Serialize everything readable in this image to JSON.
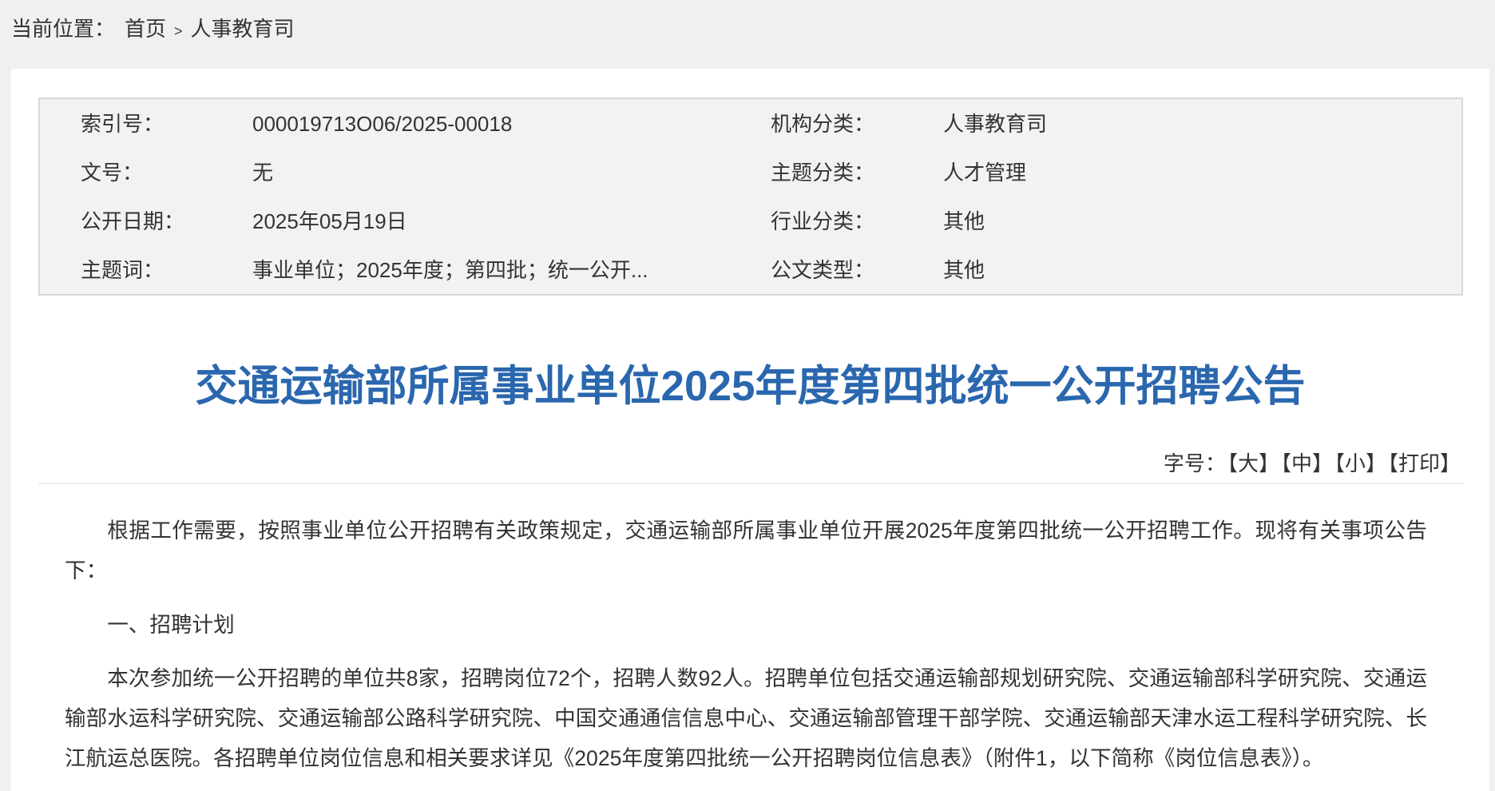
{
  "breadcrumb": {
    "label": "当前位置：",
    "separator": ">",
    "items": [
      "首页",
      "人事教育司"
    ]
  },
  "meta": {
    "rows": [
      {
        "label": "索引号：",
        "value": "000019713O06/2025-00018",
        "label2": "机构分类：",
        "value2": "人事教育司"
      },
      {
        "label": "文号：",
        "value": "无",
        "label2": "主题分类：",
        "value2": "人才管理"
      },
      {
        "label": "公开日期：",
        "value": "2025年05月19日",
        "label2": "行业分类：",
        "value2": "其他"
      },
      {
        "label": "主题词：",
        "value": "事业单位；2025年度；第四批；统一公开...",
        "label2": "公文类型：",
        "value2": "其他"
      }
    ]
  },
  "title": "交通运输部所属事业单位2025年度第四批统一公开招聘公告",
  "font_size_bar": {
    "label": "字号：",
    "options": [
      "【大】",
      "【中】",
      "【小】",
      "【打印】"
    ]
  },
  "article": {
    "paragraphs": [
      {
        "lines": [
          "根据工作需要，按照事业单位公开招聘有关政策规定，交通运输部所属事业单位开展2025年度第四批统一公开招聘工作。现将有关事项公告如",
          "下："
        ]
      },
      {
        "lines": [
          "一、招聘计划"
        ]
      },
      {
        "lines": [
          "本次参加统一公开招聘的单位共8家，招聘岗位72个，招聘人数92人。招聘单位包括交通运输部规划研究院、交通运输部科学研究院、交通运",
          "输部水运科学研究院、交通运输部公路科学研究院、中国交通通信信息中心、交通运输部管理干部学院、交通运输部天津水运工程科学研究院、长",
          "江航运总医院。各招聘单位岗位信息和相关要求详见《2025年度第四批统一公开招聘岗位信息表》（附件1，以下简称《岗位信息表》）。"
        ]
      }
    ]
  },
  "colors": {
    "page_background": "#f0f0f0",
    "panel_background": "#ffffff",
    "meta_background": "#f2f2f2",
    "meta_border": "#d8d8d8",
    "title": "#2a67ae",
    "text": "#333333"
  }
}
